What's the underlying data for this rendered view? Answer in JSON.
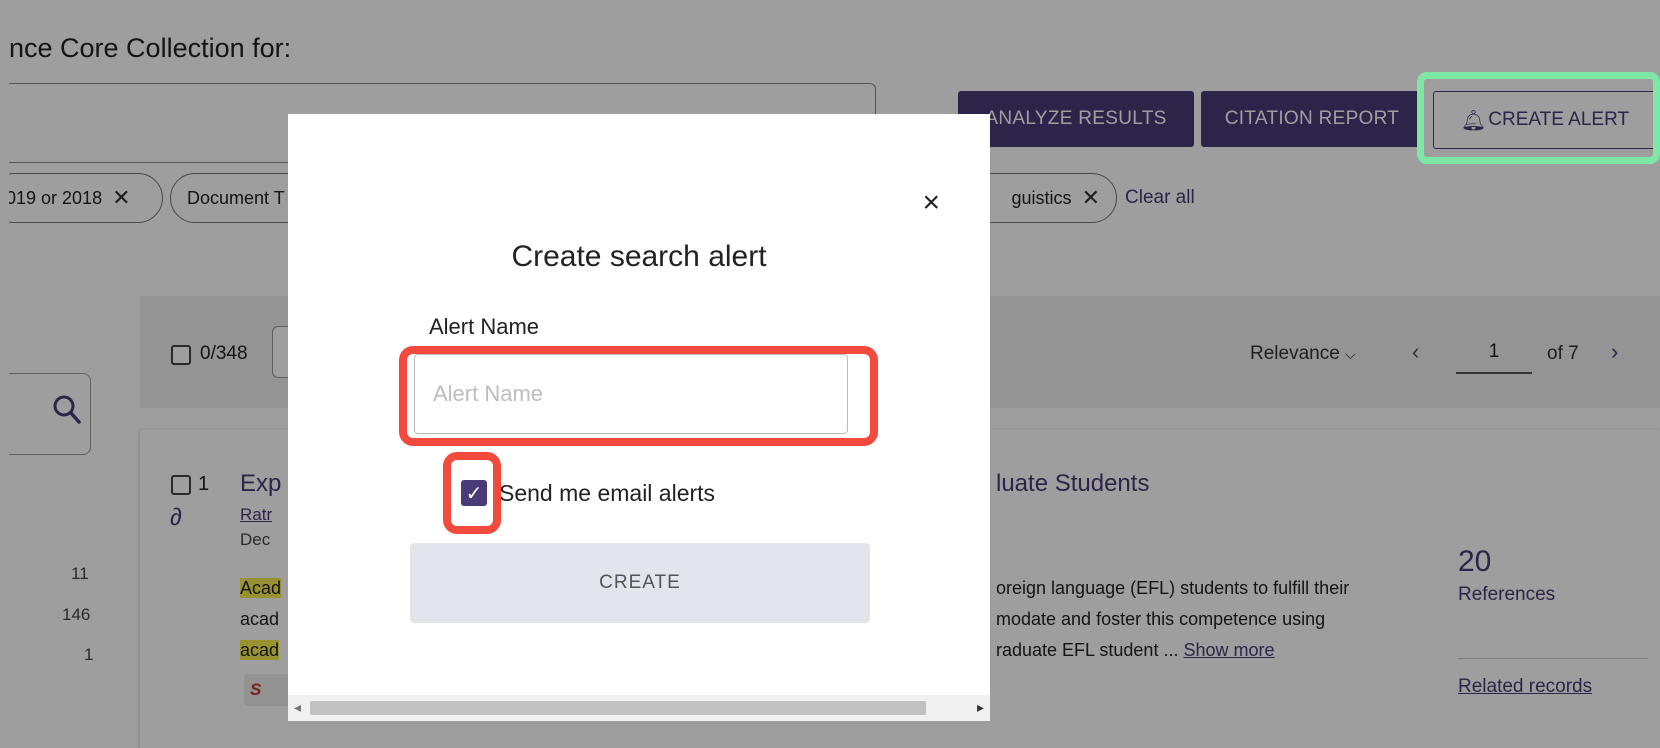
{
  "header": {
    "heading": "nce Core Collection for:",
    "buttons": {
      "analyze": "ANALYZE RESULTS",
      "citation": "CITATION REPORT",
      "alert": "CREATE ALERT"
    }
  },
  "filters": {
    "chips": [
      "019 or 2018",
      "Document T",
      "guistics"
    ],
    "clear_all": "Clear all"
  },
  "toolbar": {
    "selection": "0/348",
    "sort": "Relevance",
    "page": "1",
    "of_pages": "of 7"
  },
  "sidebar": {
    "counts": [
      "11",
      "146",
      "1"
    ]
  },
  "result": {
    "number": "1",
    "title_start": "Exp",
    "title_end": "luate Students",
    "author": "Ratr",
    "date": "Dec",
    "abstract_left": [
      "Acad",
      "acad",
      "acad"
    ],
    "abstract_right": [
      "oreign language (EFL) students to fulfill their",
      "modate and foster this competence using",
      "raduate EFL student ..."
    ],
    "show_more": "Show more",
    "references_count": "20",
    "references_label": "References",
    "related": "Related records",
    "source_badge": "S"
  },
  "modal": {
    "close": "×",
    "title": "Create search alert",
    "name_label": "Alert Name",
    "name_placeholder": "Alert Name",
    "email_checkbox_label": "Send me email alerts",
    "email_checked": true,
    "create_button": "CREATE"
  },
  "colors": {
    "brand": "#4a3a78",
    "highlight_red": "#f24a3d",
    "highlight_green": "#7fe7a6",
    "term_highlight": "#f5ec50"
  }
}
